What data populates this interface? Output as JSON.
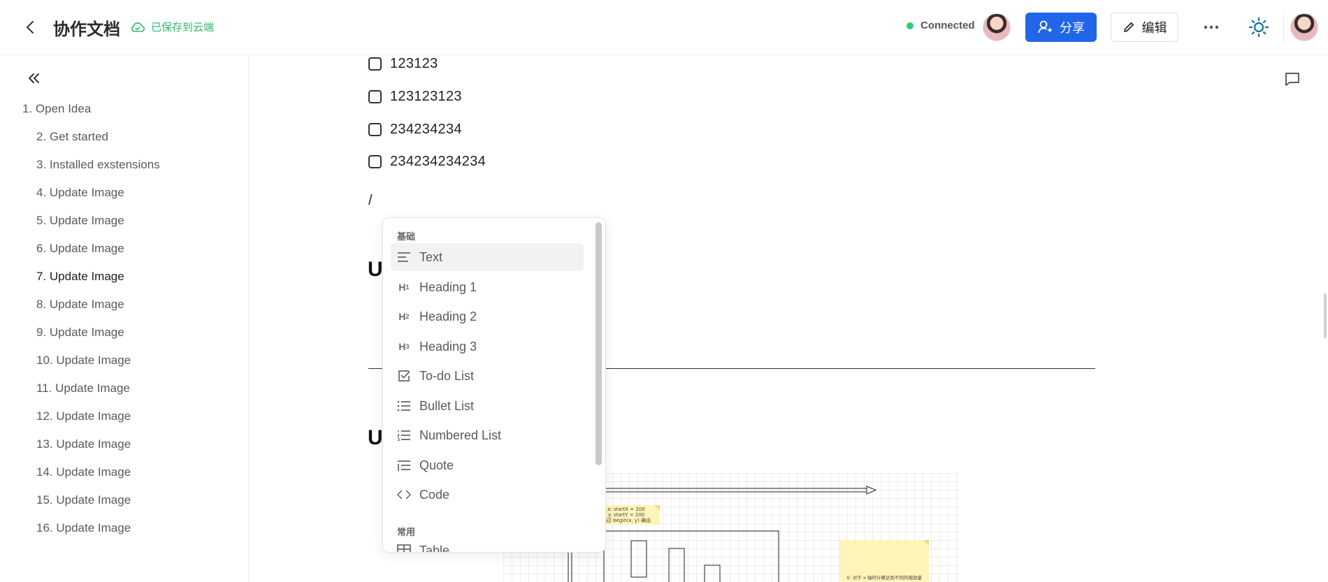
{
  "header": {
    "title": "协作文档",
    "save_status": "已保存到云端",
    "connection": "Connected",
    "share_label": "分享",
    "edit_label": "编辑"
  },
  "sidebar": {
    "items": [
      {
        "label": "1. Open Idea",
        "level": 1
      },
      {
        "label": "2. Get started",
        "level": 2
      },
      {
        "label": "3. Installed exstensions",
        "level": 2
      },
      {
        "label": "4. Update Image",
        "level": 2
      },
      {
        "label": "5. Update Image",
        "level": 2
      },
      {
        "label": "6. Update Image",
        "level": 2
      },
      {
        "label": "7. Update Image",
        "level": 2,
        "active": true
      },
      {
        "label": "8. Update Image",
        "level": 2
      },
      {
        "label": "9. Update Image",
        "level": 2
      },
      {
        "label": "10. Update Image",
        "level": 2
      },
      {
        "label": "11. Update Image",
        "level": 2
      },
      {
        "label": "12. Update Image",
        "level": 2
      },
      {
        "label": "13. Update Image",
        "level": 2
      },
      {
        "label": "14. Update Image",
        "level": 2
      },
      {
        "label": "15. Update Image",
        "level": 2
      },
      {
        "label": "16. Update Image",
        "level": 2
      }
    ]
  },
  "editor": {
    "todos": [
      "123123",
      "123123123",
      "234234234",
      "234234234234"
    ],
    "slash_text": "/",
    "heading_initial_1": "U",
    "heading_initial_2": "U",
    "board": {
      "note1_lines": [
        "x: startX = 200",
        "y: startY = 200",
        "通过 begin(x, y) 确出"
      ],
      "note2_text": "X: 对于 x 轴的计算达到不同的缩放量"
    }
  },
  "slash_menu": {
    "group_basic": "基础",
    "group_common": "常用",
    "items": [
      {
        "label": "Text",
        "icon": "text-icon"
      },
      {
        "label": "Heading 1",
        "icon": "heading1-icon",
        "glyph": "H",
        "sub": "1"
      },
      {
        "label": "Heading 2",
        "icon": "heading2-icon",
        "glyph": "H",
        "sub": "2"
      },
      {
        "label": "Heading 3",
        "icon": "heading3-icon",
        "glyph": "H",
        "sub": "3"
      },
      {
        "label": "To-do List",
        "icon": "checkbox-icon"
      },
      {
        "label": "Bullet List",
        "icon": "bullet-list-icon"
      },
      {
        "label": "Numbered List",
        "icon": "numbered-list-icon"
      },
      {
        "label": "Quote",
        "icon": "quote-icon"
      },
      {
        "label": "Code",
        "icon": "code-icon"
      }
    ],
    "common_items": [
      {
        "label": "Table",
        "icon": "table-icon"
      }
    ]
  },
  "colors": {
    "accent": "#2166e8",
    "saved": "#2eb872",
    "connected": "#2ecc71"
  }
}
